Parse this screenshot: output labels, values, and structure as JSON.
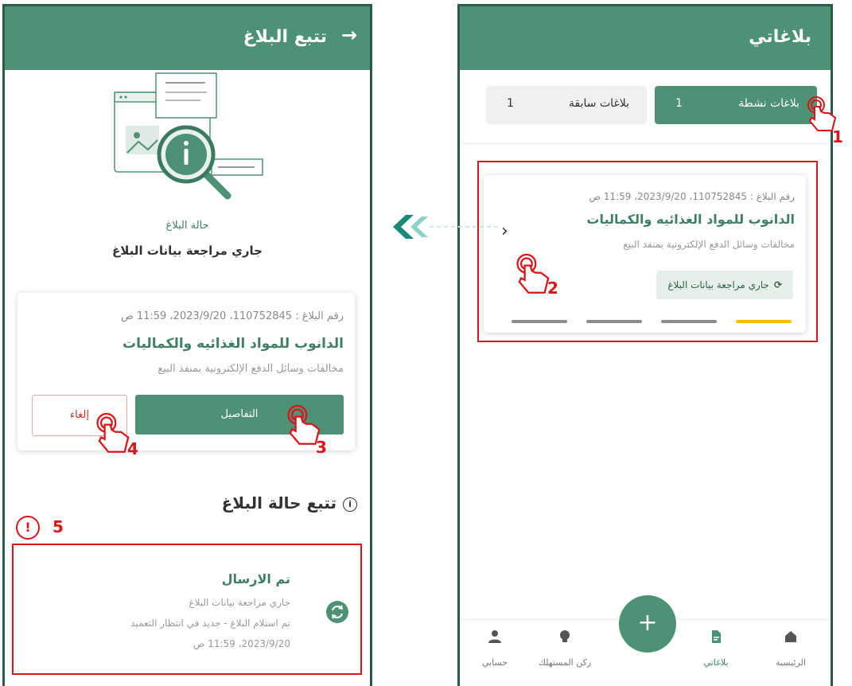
{
  "left_screen": {
    "header": {
      "title": "تتبع البلاغ",
      "back_icon": "arrow-right-icon"
    },
    "status": {
      "label": "حالة البلاغ",
      "value": "جاري مراجعة بيانات البلاغ"
    },
    "report_card": {
      "meta": "رقم البلاغ : 110752845، 2023/9/20، 11:59 ص",
      "store": "الدانوب للمواد الغذائيه والكماليات",
      "category": "مخالفات وسائل الدفع الإلكترونية بمنفذ البيع",
      "details_label": "التفاصيل",
      "cancel_label": "إلغاء"
    },
    "tracking": {
      "title": "تتبع حالة البلاغ",
      "event_title": "تم الارسال",
      "event_line1": "جاري مراجعة بيانات البلاغ",
      "event_line2": "تم استلام البلاغ - جديد في انتظار التعميد",
      "event_time": "2023/9/20، 11:59 ص"
    }
  },
  "right_screen": {
    "header": {
      "title": "بلاغاتي"
    },
    "tabs": [
      {
        "label": "بلاغات نشطة",
        "count": "1",
        "active": true
      },
      {
        "label": "بلاغات سابقة",
        "count": "1",
        "active": false
      }
    ],
    "report_card": {
      "meta": "رقم البلاغ : 110752845، 2023/9/20، 11:59 ص",
      "store": "الدانوب للمواد الغذائيه والكماليات",
      "category": "مخالفات وسائل الدفع الإلكترونية بمنفذ البيع",
      "status_chip": "جاري مراجعة بيانات البلاغ",
      "progress_steps_done": 1,
      "progress_steps_total": 4
    },
    "bottom_nav": [
      {
        "label": "الرئيسية",
        "icon": "home-icon",
        "active": false
      },
      {
        "label": "بلاغاتي",
        "icon": "document-icon",
        "active": true
      },
      {
        "label": "ركن المستهلك",
        "icon": "lightbulb-icon",
        "active": false
      },
      {
        "label": "حسابي",
        "icon": "user-icon",
        "active": false
      }
    ],
    "fab_icon": "plus-icon"
  },
  "annotations": {
    "step1": "1",
    "step2": "2",
    "step3": "3",
    "step4": "4",
    "step5": "5",
    "warning_symbol": "!"
  },
  "colors": {
    "primary": "#4d9274",
    "dark_border": "#2c5a4a",
    "highlight": "#d9151a",
    "progress_active": "#f2c200",
    "progress_idle": "#8c8c8c"
  }
}
